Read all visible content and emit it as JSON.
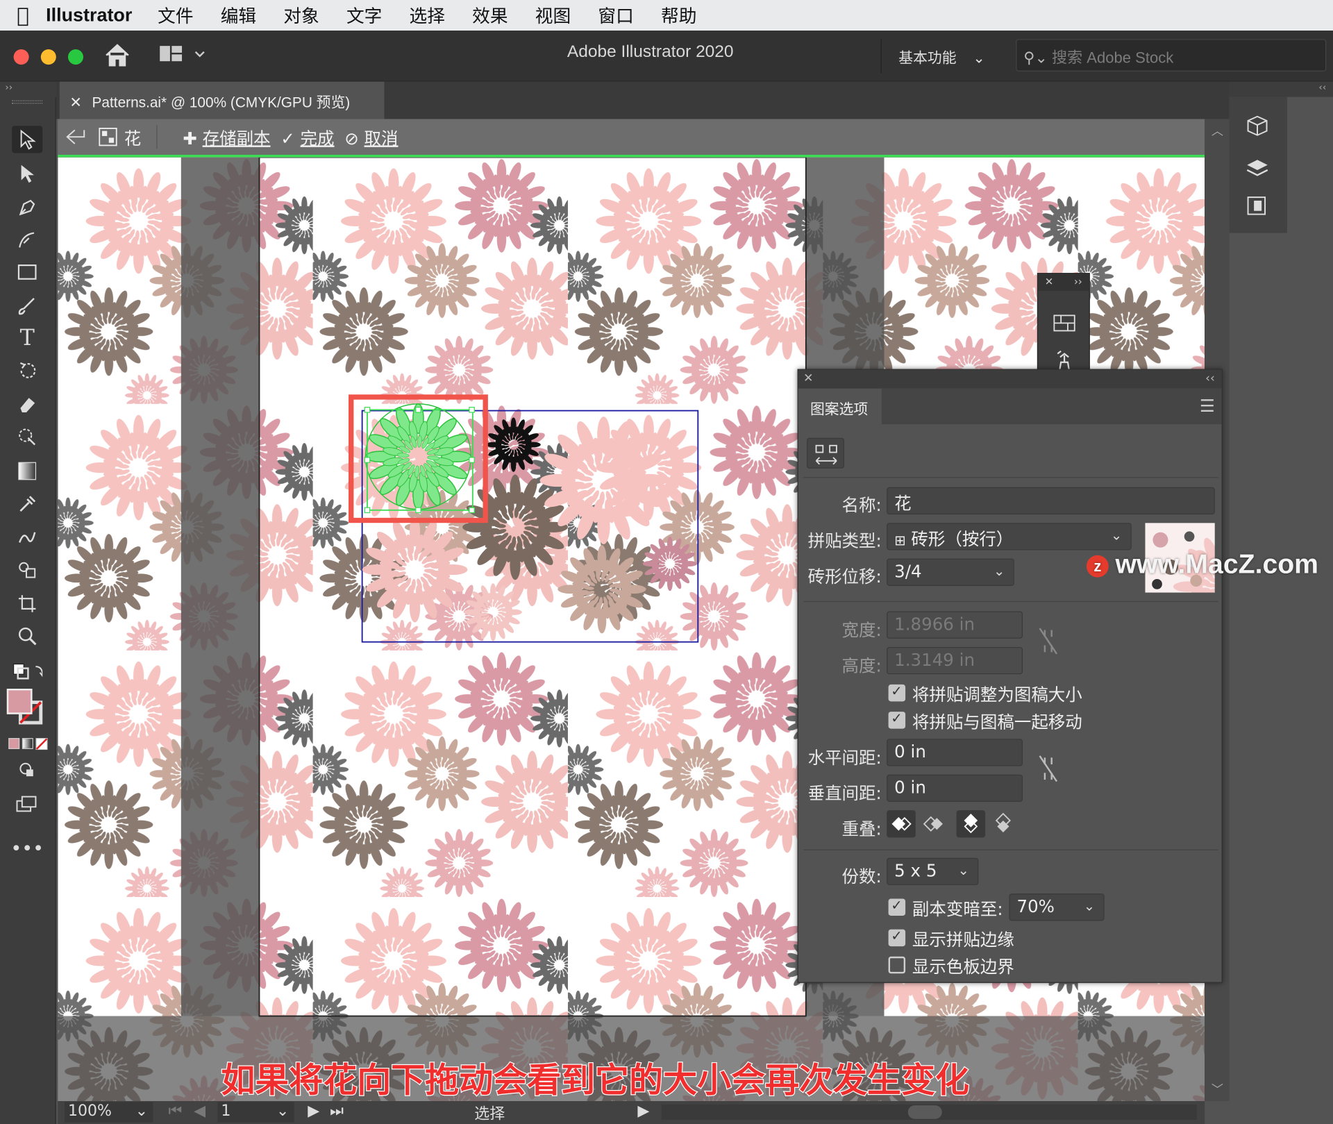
{
  "menubar": {
    "app": "Illustrator",
    "items": [
      "文件",
      "编辑",
      "对象",
      "文字",
      "选择",
      "效果",
      "视图",
      "窗口",
      "帮助"
    ]
  },
  "titlebar": {
    "title": "Adobe Illustrator 2020",
    "workspace": "基本功能",
    "search_placeholder": "搜索 Adobe Stock"
  },
  "document_tab": {
    "label": "Patterns.ai* @ 100% (CMYK/GPU 预览)"
  },
  "pattern_bar": {
    "pattern_name": "花",
    "save_copy": "存储副本",
    "done": "完成",
    "cancel": "取消"
  },
  "pattern_options": {
    "panel_title": "图案选项",
    "name_label": "名称:",
    "name_value": "花",
    "tile_type_label": "拼贴类型:",
    "tile_type_value": "砖形（按行）",
    "brick_offset_label": "砖形位移:",
    "brick_offset_value": "3/4",
    "width_label": "宽度:",
    "width_value": "1.8966 in",
    "height_label": "高度:",
    "height_value": "1.3149 in",
    "size_tile_to_art": {
      "label": "将拼贴调整为图稿大小",
      "checked": true
    },
    "move_tile_with_art": {
      "label": "将拼贴与图稿一起移动",
      "checked": true
    },
    "h_spacing_label": "水平间距:",
    "h_spacing_value": "0 in",
    "v_spacing_label": "垂直间距:",
    "v_spacing_value": "0 in",
    "overlap_label": "重叠:",
    "copies_label": "份数:",
    "copies_value": "5 x 5",
    "dim_copies": {
      "label": "副本变暗至:",
      "checked": true,
      "value": "70%"
    },
    "show_tile_edge": {
      "label": "显示拼贴边缘",
      "checked": true
    },
    "show_swatch_bounds": {
      "label": "显示色板边界",
      "checked": false
    }
  },
  "status": {
    "zoom": "100%",
    "artboard": "1",
    "tool": "选择"
  },
  "watermark": "www.MacZ.com",
  "caption": "如果将花向下拖动会看到它的大小会再次发生变化",
  "colors": {
    "fill_swatch": "#d89aa2",
    "selection_green": "#3cdc54",
    "highlight_red": "#f0544a",
    "tile_bounds_blue": "#1a1aa0"
  }
}
